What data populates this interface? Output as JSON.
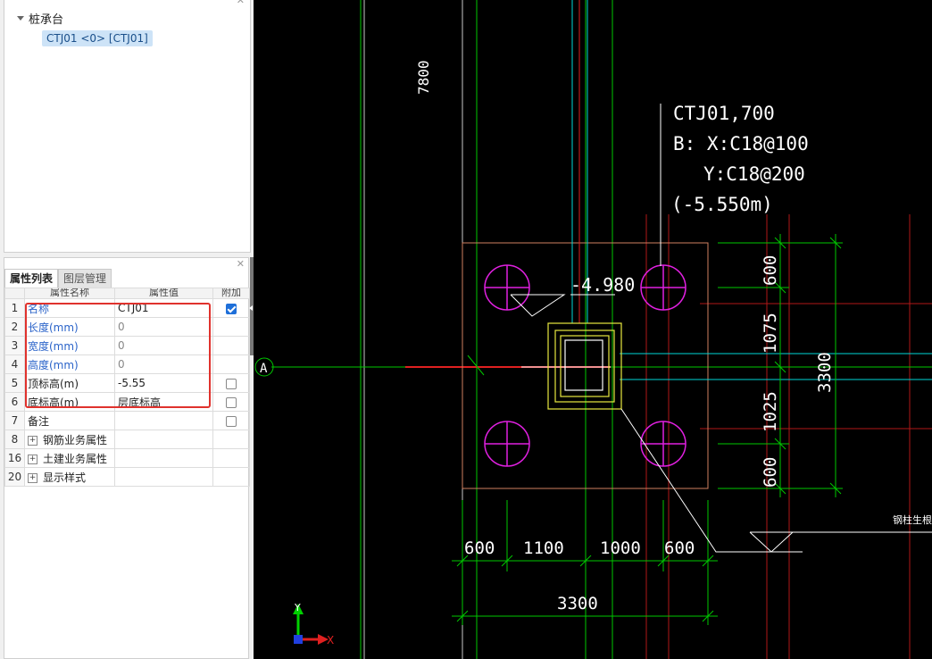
{
  "tree": {
    "root_label": "桩承台",
    "child_label": "CTJ01 <0> [CTJ01]"
  },
  "props_panel": {
    "tabs": [
      "属性列表",
      "图层管理"
    ],
    "columns": [
      "属性名称",
      "属性值",
      "附加"
    ],
    "rows": [
      {
        "num": "1",
        "name": "名称",
        "value": "CTJ01",
        "checkbox": true,
        "checked": true
      },
      {
        "num": "2",
        "name": "长度(mm)",
        "value": "0",
        "checkbox": false
      },
      {
        "num": "3",
        "name": "宽度(mm)",
        "value": "0",
        "checkbox": false
      },
      {
        "num": "4",
        "name": "高度(mm)",
        "value": "0",
        "checkbox": false
      },
      {
        "num": "5",
        "name": "顶标高(m)",
        "value": "-5.55",
        "checkbox": true,
        "checked": false
      },
      {
        "num": "6",
        "name": "底标高(m)",
        "value": "层底标高",
        "checkbox": true,
        "checked": false
      },
      {
        "num": "7",
        "name": "备注",
        "value": "",
        "checkbox": true,
        "checked": false
      },
      {
        "num": "8",
        "name": "钢筋业务属性",
        "value": "",
        "expander": "+"
      },
      {
        "num": "16",
        "name": "土建业务属性",
        "value": "",
        "expander": "+"
      },
      {
        "num": "20",
        "name": "显示样式",
        "value": "",
        "expander": "+"
      }
    ]
  },
  "cad": {
    "dim_top": "7800",
    "note_line1": "CTJ01,700",
    "note_line2": "B: X:C18@100",
    "note_line3": "Y:C18@200",
    "note_line4": "(-5.550m)",
    "level_mark": "-4.980",
    "axis_label": "A",
    "dim_right_1": "600",
    "dim_right_2": "1075",
    "dim_right_3": "1025",
    "dim_right_4": "600",
    "dim_right_total": "3300",
    "dim_bottom_1": "600",
    "dim_bottom_2": "1100",
    "dim_bottom_3": "1000",
    "dim_bottom_4": "600",
    "dim_bottom_total": "3300",
    "side_note": "钢柱生根标高",
    "ucs_y": "Y",
    "ucs_x": "X"
  },
  "colors": {
    "cad_bg": "#000000",
    "green": "#00d000",
    "cyan": "#00d8d8",
    "red": "#e02020",
    "magenta": "#e020e0",
    "yellow": "#e8e840",
    "redbox": "#e0322d"
  }
}
